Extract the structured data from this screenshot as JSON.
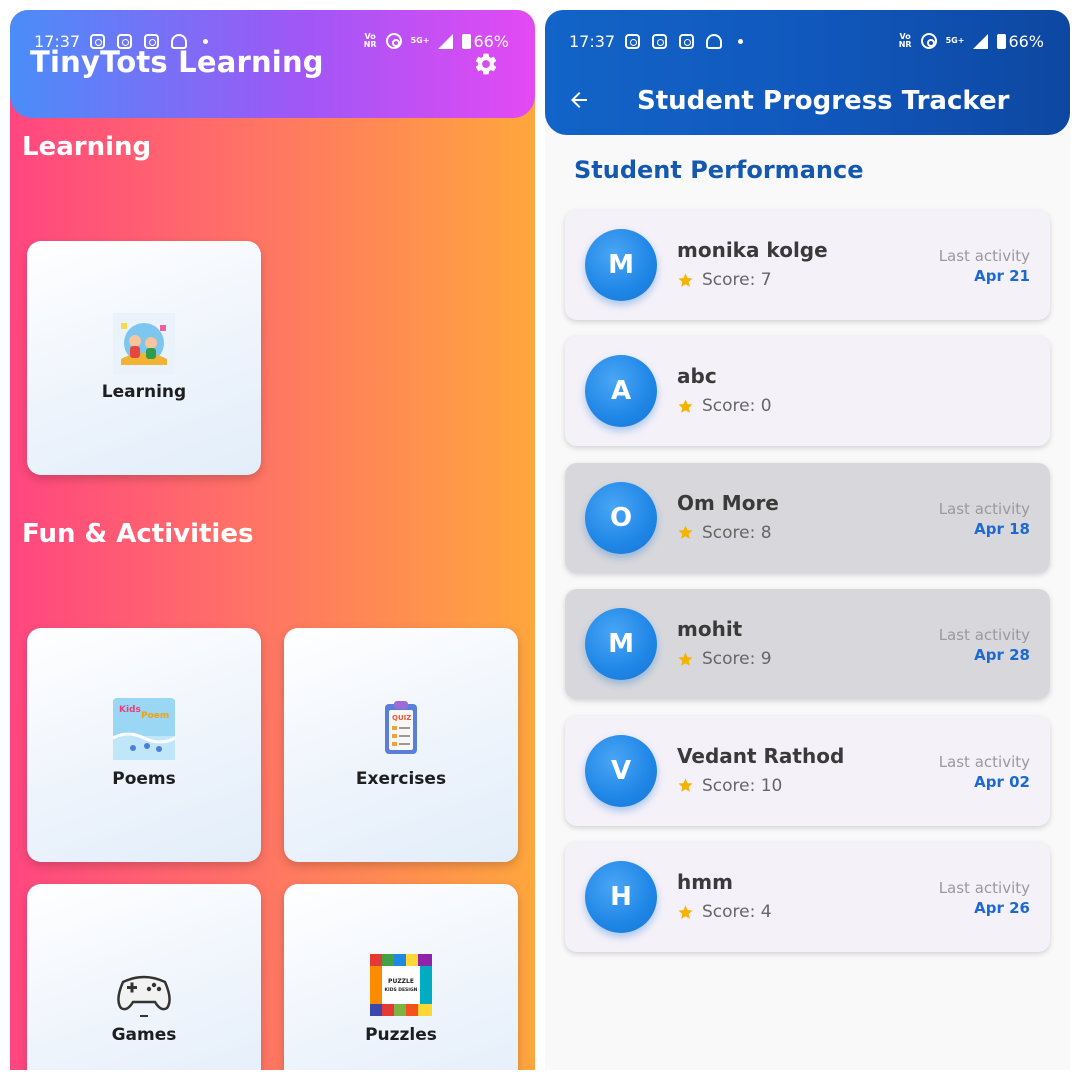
{
  "status_bar": {
    "time": "17:37",
    "net_top": "Vo",
    "net_bottom": "NR",
    "gen": "5G+",
    "battery": "66%"
  },
  "home": {
    "app_title": "TinyTots Learning",
    "sections": {
      "learning": "Learning",
      "fun": "Fun & Activities"
    },
    "cards": {
      "learning": "Learning",
      "poems": "Poems",
      "exercises": "Exercises",
      "games": "Games",
      "puzzles": "Puzzles"
    },
    "thumb_text": {
      "kids": "Kids",
      "poem": "Poem",
      "quiz": "QUIZ",
      "puzzle1": "PUZZLE",
      "puzzle2": "KIDS DESIGN"
    }
  },
  "tracker": {
    "title": "Student Progress Tracker",
    "subtitle": "Student Performance",
    "last_activity_label": "Last activity",
    "students": [
      {
        "initial": "M",
        "name": "monika kolge",
        "score": "Score: 7",
        "date": "Apr 21",
        "highlighted": false,
        "has_activity": true
      },
      {
        "initial": "A",
        "name": "abc",
        "score": "Score: 0",
        "date": "",
        "highlighted": false,
        "has_activity": false
      },
      {
        "initial": "O",
        "name": "Om More",
        "score": "Score: 8",
        "date": "Apr 18",
        "highlighted": true,
        "has_activity": true
      },
      {
        "initial": "M",
        "name": "mohit",
        "score": "Score: 9",
        "date": "Apr 28",
        "highlighted": true,
        "has_activity": true
      },
      {
        "initial": "V",
        "name": "Vedant Rathod",
        "score": "Score: 10",
        "date": "Apr 02",
        "highlighted": false,
        "has_activity": true
      },
      {
        "initial": "H",
        "name": "hmm",
        "score": "Score: 4",
        "date": "Apr 26",
        "highlighted": false,
        "has_activity": true
      }
    ]
  },
  "colors": {
    "left_bg_start": "#ff4680",
    "left_bg_end": "#ffa63d",
    "left_header_start": "#4a8df8",
    "left_header_end": "#e449f3",
    "right_header": "#1158bd",
    "accent_blue": "#1458b0",
    "star": "#f5b301"
  },
  "icons": {
    "settings": "gear-icon",
    "back": "arrow-left-icon",
    "score": "star-icon"
  }
}
